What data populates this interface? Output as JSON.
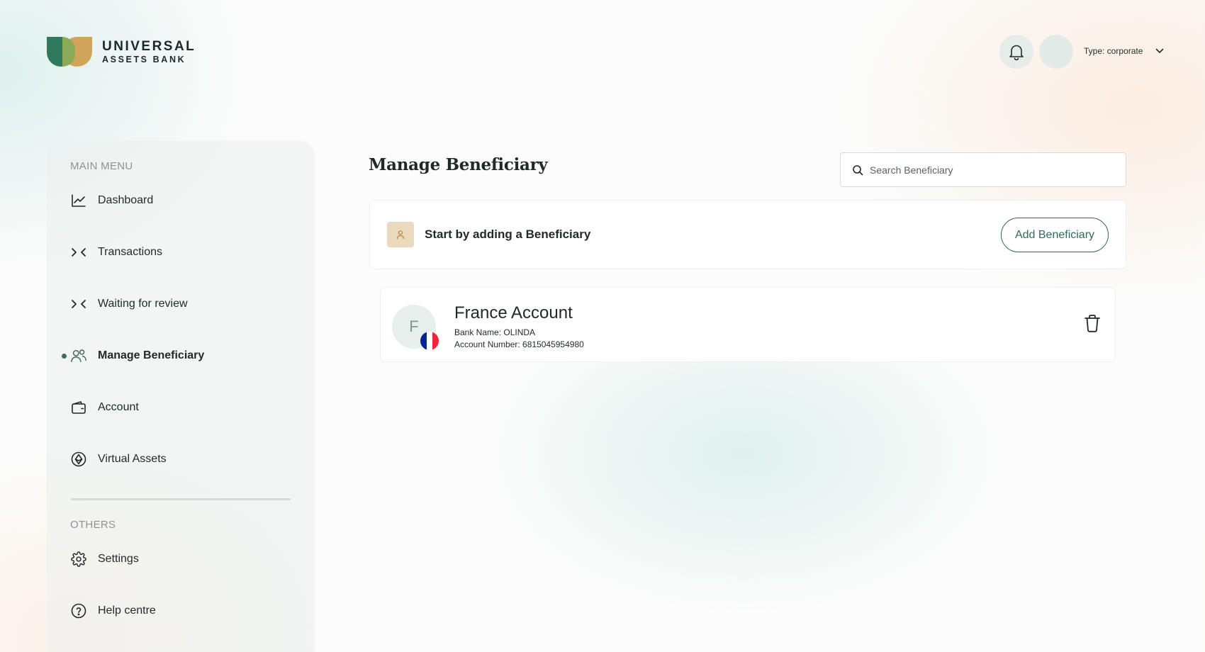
{
  "brand": {
    "name_line1": "UNIVERSAL",
    "name_line2": "ASSETS BANK"
  },
  "header": {
    "account_type": "Type: corporate",
    "icons": [
      "bell-icon",
      "chevron-down-icon"
    ]
  },
  "sidebar": {
    "main_menu_label": "MAIN MENU",
    "items": [
      {
        "label": "Dashboard",
        "icon": "chart-line-icon"
      },
      {
        "label": "Transactions",
        "icon": "arrows-icon"
      },
      {
        "label": "Waiting for review",
        "icon": "arrows-icon"
      },
      {
        "label": "Manage Beneficiary",
        "icon": "users-icon",
        "active": true
      },
      {
        "label": "Account",
        "icon": "wallet-icon"
      },
      {
        "label": "Virtual Assets",
        "icon": "crypto-icon"
      }
    ],
    "others_label": "OTHERS",
    "others": [
      {
        "label": "Settings",
        "icon": "gear-icon"
      },
      {
        "label": "Help centre",
        "icon": "help-icon"
      }
    ]
  },
  "main": {
    "title": "Manage Beneficiary",
    "search": {
      "placeholder": "Search Beneficiary",
      "value": ""
    },
    "add_card": {
      "message": "Start by adding a Beneficiary",
      "button_label": "Add Beneficiary"
    },
    "beneficiaries": [
      {
        "initial": "F",
        "name": "France Account",
        "bank": "Bank Name: OLINDA",
        "account": "Account Number: 6815045954980",
        "flag_colors": [
          "#002395",
          "#ffffff",
          "#ed2939"
        ]
      }
    ]
  },
  "colors": {
    "accent": "#2f6b58",
    "logo_green": "#2f7a5c",
    "logo_gold": "#d0a45a",
    "badge_bg": "#ead9bd"
  }
}
